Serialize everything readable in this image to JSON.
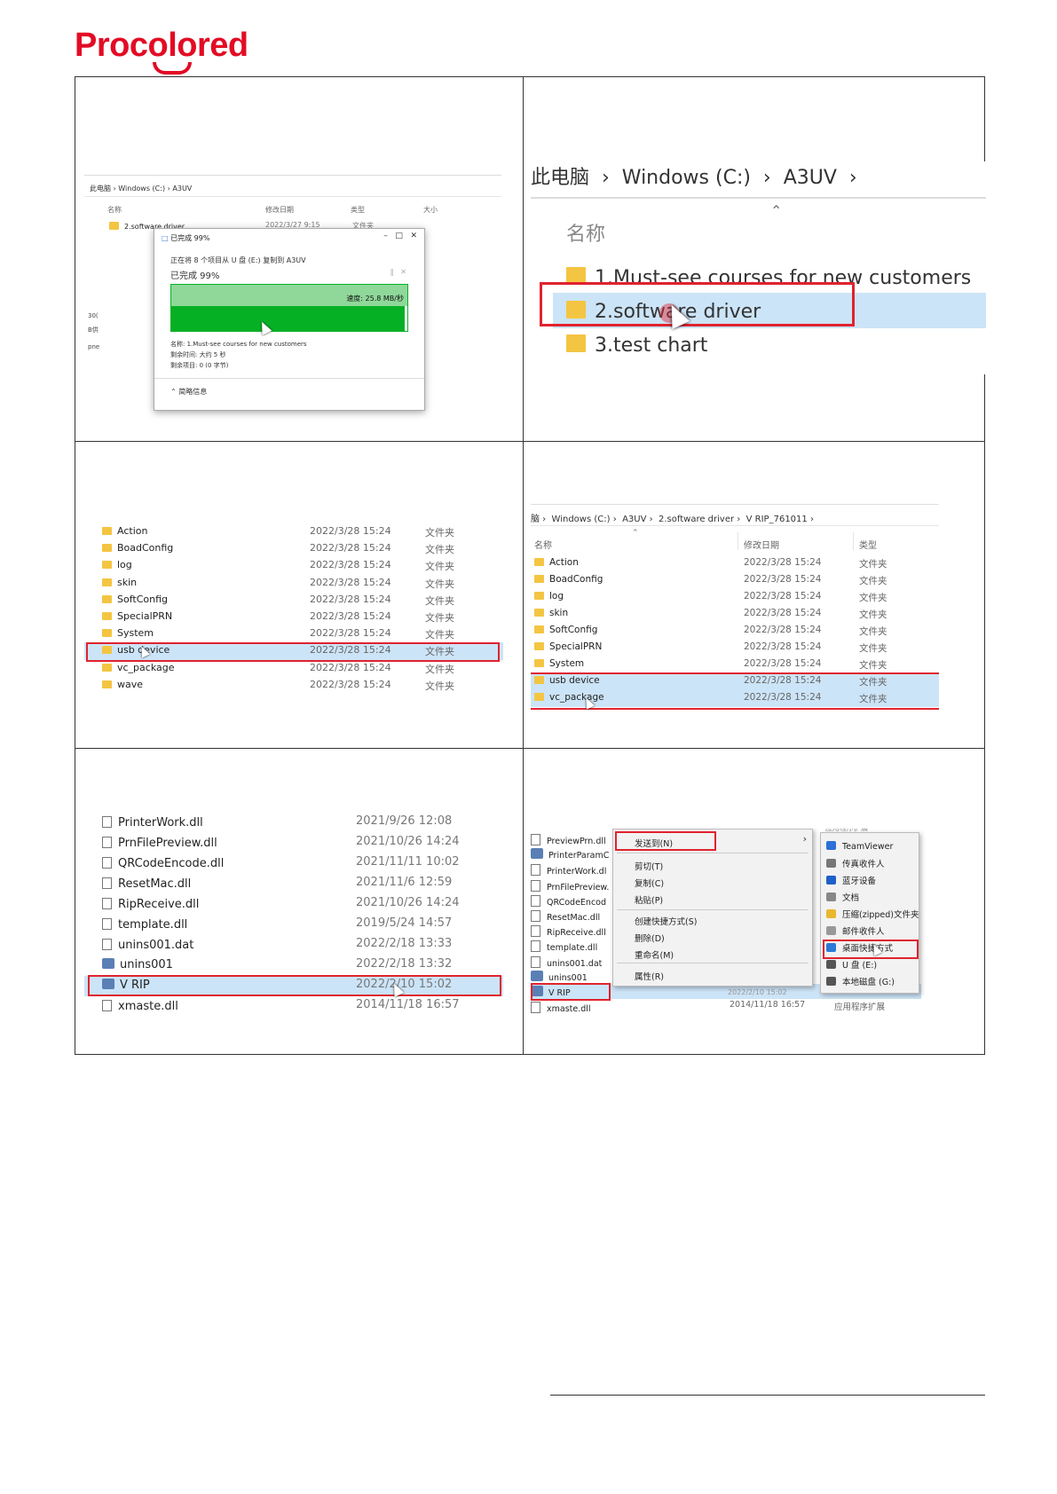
{
  "brand": {
    "logo_text": "Procolored",
    "color": "#e30b24"
  },
  "panel1": {
    "breadcrumb": [
      "此电脑",
      "Windows (C:)",
      "A3UV"
    ],
    "columns": [
      "名称",
      "修改日期",
      "类型",
      "大小"
    ],
    "row_name": "2.software driver",
    "row_date": "2022/3/27 9:15",
    "row_type": "文件夹",
    "left_frags": [
      "30(",
      "B供",
      "pne"
    ],
    "dialog": {
      "title": "已完成 99%",
      "copy_line": "正在将 8 个项目从 U 盘 (E:) 复制到 A3UV",
      "progress": "已完成 99%",
      "speed": "速度: 25.8 MB/秒",
      "progress_fraction": 0.99,
      "name_line": "名称: 1.Must-see courses for new customers",
      "time_line": "剩余时间: 大约 5 秒",
      "items_line": "剩余项目: 0 (0 字节)",
      "details": "简略信息"
    }
  },
  "panel2": {
    "breadcrumb": [
      "此电脑",
      "Windows (C:)",
      "A3UV"
    ],
    "column": "名称",
    "items": [
      "1.Must-see courses for new customers",
      "2.software driver",
      "3.test chart"
    ]
  },
  "panel3": {
    "rows": [
      {
        "name": "Action",
        "date": "2022/3/28 15:24",
        "type": "文件夹"
      },
      {
        "name": "BoadConfig",
        "date": "2022/3/28 15:24",
        "type": "文件夹"
      },
      {
        "name": "log",
        "date": "2022/3/28 15:24",
        "type": "文件夹"
      },
      {
        "name": "skin",
        "date": "2022/3/28 15:24",
        "type": "文件夹"
      },
      {
        "name": "SoftConfig",
        "date": "2022/3/28 15:24",
        "type": "文件夹"
      },
      {
        "name": "SpecialPRN",
        "date": "2022/3/28 15:24",
        "type": "文件夹"
      },
      {
        "name": "System",
        "date": "2022/3/28 15:24",
        "type": "文件夹"
      },
      {
        "name": "usb device",
        "date": "2022/3/28 15:24",
        "type": "文件夹"
      },
      {
        "name": "vc_package",
        "date": "2022/3/28 15:24",
        "type": "文件夹"
      },
      {
        "name": "wave",
        "date": "2022/3/28 15:24",
        "type": "文件夹"
      }
    ]
  },
  "panel4": {
    "breadcrumb": [
      "脑",
      "Windows (C:)",
      "A3UV",
      "2.software driver",
      "V RIP_761011"
    ],
    "columns": [
      "名称",
      "修改日期",
      "类型"
    ],
    "rows": [
      {
        "name": "Action",
        "date": "2022/3/28 15:24",
        "type": "文件夹"
      },
      {
        "name": "BoadConfig",
        "date": "2022/3/28 15:24",
        "type": "文件夹"
      },
      {
        "name": "log",
        "date": "2022/3/28 15:24",
        "type": "文件夹"
      },
      {
        "name": "skin",
        "date": "2022/3/28 15:24",
        "type": "文件夹"
      },
      {
        "name": "SoftConfig",
        "date": "2022/3/28 15:24",
        "type": "文件夹"
      },
      {
        "name": "SpecialPRN",
        "date": "2022/3/28 15:24",
        "type": "文件夹"
      },
      {
        "name": "System",
        "date": "2022/3/28 15:24",
        "type": "文件夹"
      },
      {
        "name": "usb device",
        "date": "2022/3/28 15:24",
        "type": "文件夹"
      },
      {
        "name": "vc_package",
        "date": "2022/3/28 15:24",
        "type": "文件夹"
      }
    ]
  },
  "panel5": {
    "rows": [
      {
        "name": "PrinterWork.dll",
        "date": "2021/9/26 12:08"
      },
      {
        "name": "PrnFilePreview.dll",
        "date": "2021/10/26 14:24"
      },
      {
        "name": "QRCodeEncode.dll",
        "date": "2021/11/11 10:02"
      },
      {
        "name": "ResetMac.dll",
        "date": "2021/11/6 12:59"
      },
      {
        "name": "RipReceive.dll",
        "date": "2021/10/26 14:24"
      },
      {
        "name": "template.dll",
        "date": "2019/5/24 14:57"
      },
      {
        "name": "unins001.dat",
        "date": "2022/2/18 13:33"
      },
      {
        "name": "unins001",
        "date": "2022/2/18 13:32"
      },
      {
        "name": "V RIP",
        "date": "2022/2/10 15:02"
      },
      {
        "name": "xmaste.dll",
        "date": "2014/11/18 16:57"
      }
    ]
  },
  "panel6": {
    "files": [
      "PreviewPrn.dll",
      "PrinterParamC",
      "PrinterWork.dl",
      "PrnFilePreview.",
      "QRCodeEncod",
      "ResetMac.dll",
      "RipReceive.dll",
      "template.dll",
      "unins001.dat",
      "unins001",
      "V RIP",
      "xmaste.dll"
    ],
    "last_date": "2014/11/18 16:57",
    "last_type": "应用程序扩展",
    "menu": [
      "发送到(N)",
      "剪切(T)",
      "复制(C)",
      "粘贴(P)",
      "创建快捷方式(S)",
      "删除(D)",
      "重命名(M)",
      "属性(R)"
    ],
    "submenu_header": "应用程序扩展",
    "submenu": [
      "TeamViewer",
      "传真收件人",
      "蓝牙设备",
      "文档",
      "压缩(zipped)文件夹",
      "邮件收件人",
      "桌面快捷方式",
      "U 盘 (E:)",
      "本地磁盘 (G:)"
    ],
    "behind_date": "2022/2/10 15:02"
  },
  "colors": {
    "highlight": "#e0232f",
    "selection": "#cce4f7",
    "progress_green": "#06b025"
  }
}
